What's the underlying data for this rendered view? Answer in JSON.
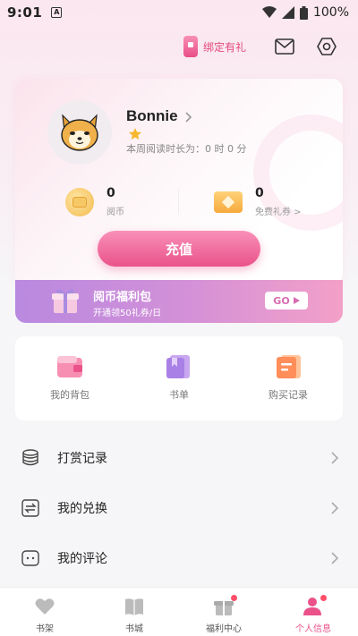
{
  "status": {
    "time": "9:01",
    "battery": "100%"
  },
  "header": {
    "bind_gift_label": "绑定有礼"
  },
  "profile": {
    "name": "Bonnie",
    "reading_time": "本周阅读时长为：0 时 0 分",
    "coins_value": "0",
    "coins_label": "阅币",
    "coupons_value": "0",
    "coupons_label": "免费礼券 >",
    "recharge_label": "充值"
  },
  "welfare": {
    "title": "阅币福利包",
    "subtitle": "开通领50礼券/日",
    "go_label": "GO"
  },
  "quick_actions": [
    {
      "label": "我的背包",
      "icon": "wallet-icon"
    },
    {
      "label": "书单",
      "icon": "book-list-icon"
    },
    {
      "label": "购买记录",
      "icon": "purchase-record-icon"
    }
  ],
  "menu": [
    {
      "label": "打赏记录",
      "icon": "coin-stack-icon"
    },
    {
      "label": "我的兑换",
      "icon": "exchange-icon"
    },
    {
      "label": "我的评论",
      "icon": "comment-icon"
    }
  ],
  "bottom_nav": [
    {
      "label": "书架",
      "icon": "heart-icon",
      "active": false
    },
    {
      "label": "书城",
      "icon": "book-icon",
      "active": false
    },
    {
      "label": "福利中心",
      "icon": "gift-icon",
      "active": false
    },
    {
      "label": "个人信息",
      "icon": "person-icon",
      "active": true
    }
  ],
  "colors": {
    "accent": "#ea5289",
    "banner_start": "#b989e0",
    "banner_end": "#f3a0c8"
  }
}
